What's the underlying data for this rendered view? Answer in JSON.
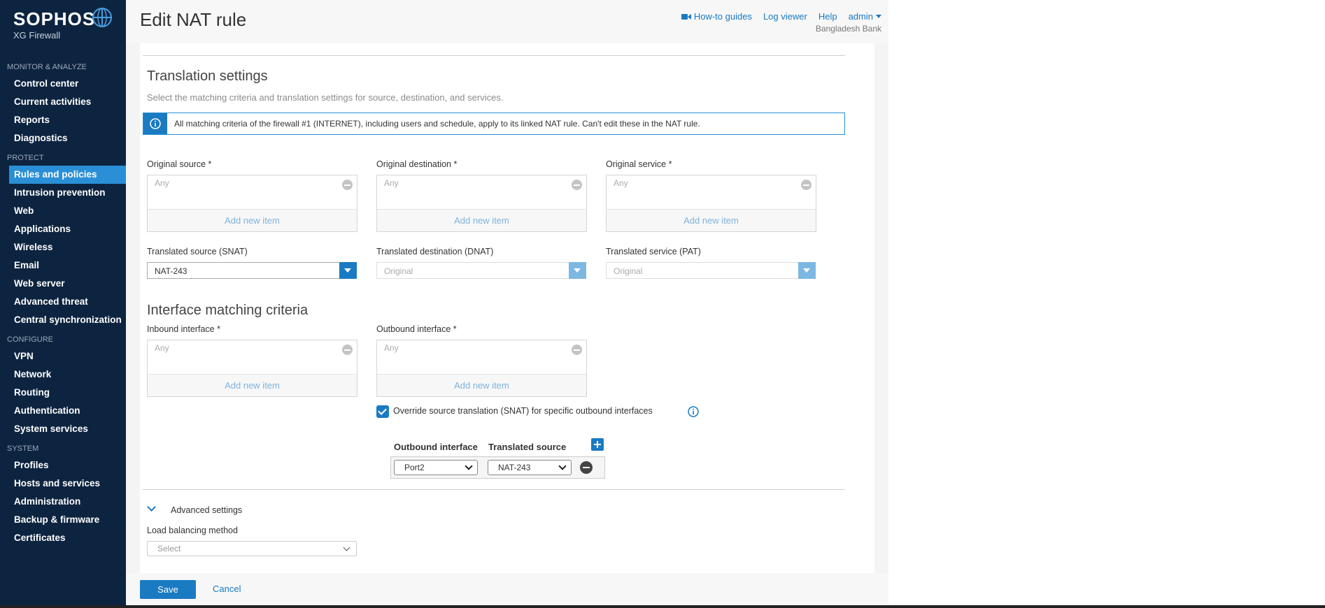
{
  "brand": {
    "name": "SOPHOS",
    "product": "XG Firewall"
  },
  "sidebar": {
    "sections": [
      {
        "title": "MONITOR & ANALYZE",
        "items": [
          "Control center",
          "Current activities",
          "Reports",
          "Diagnostics"
        ]
      },
      {
        "title": "PROTECT",
        "items": [
          "Rules and policies",
          "Intrusion prevention",
          "Web",
          "Applications",
          "Wireless",
          "Email",
          "Web server",
          "Advanced threat",
          "Central synchronization"
        ]
      },
      {
        "title": "CONFIGURE",
        "items": [
          "VPN",
          "Network",
          "Routing",
          "Authentication",
          "System services"
        ]
      },
      {
        "title": "SYSTEM",
        "items": [
          "Profiles",
          "Hosts and services",
          "Administration",
          "Backup & firmware",
          "Certificates"
        ]
      }
    ],
    "active_item": "Rules and policies"
  },
  "header": {
    "title": "Edit NAT rule",
    "links": {
      "guides": "How-to guides",
      "log_viewer": "Log viewer",
      "help": "Help",
      "user": "admin"
    },
    "tenant": "Bangladesh Bank"
  },
  "translation": {
    "title": "Translation settings",
    "subtitle": "Select the matching criteria and translation settings for source, destination, and services.",
    "info": "All matching criteria of the firewall #1 (INTERNET), including users and schedule, apply to its linked NAT rule. Can't edit these in the NAT rule.",
    "original_source": {
      "label": "Original source *",
      "value": "Any",
      "add": "Add new item"
    },
    "original_destination": {
      "label": "Original destination *",
      "value": "Any",
      "add": "Add new item"
    },
    "original_service": {
      "label": "Original service *",
      "value": "Any",
      "add": "Add new item"
    },
    "translated_source": {
      "label": "Translated source (SNAT)",
      "value": "NAT-243"
    },
    "translated_destination": {
      "label": "Translated destination (DNAT)",
      "value": "Original"
    },
    "translated_service": {
      "label": "Translated service (PAT)",
      "value": "Original"
    }
  },
  "interface": {
    "title": "Interface matching criteria",
    "inbound": {
      "label": "Inbound interface *",
      "value": "Any",
      "add": "Add new item"
    },
    "outbound": {
      "label": "Outbound interface *",
      "value": "Any",
      "add": "Add new item"
    },
    "override_label": "Override source translation (SNAT) for specific outbound interfaces",
    "override_checked": true,
    "table": {
      "col_interface": "Outbound interface",
      "col_source": "Translated source",
      "rows": [
        {
          "interface": "Port2",
          "source": "NAT-243"
        }
      ]
    }
  },
  "advanced": {
    "title": "Advanced settings",
    "lb_label": "Load balancing method",
    "lb_placeholder": "Select"
  },
  "footer": {
    "save": "Save",
    "cancel": "Cancel"
  },
  "colors": {
    "accent": "#1a7ac2",
    "sidebar_bg": "#0d2440",
    "active_item": "#2a8fd6"
  }
}
